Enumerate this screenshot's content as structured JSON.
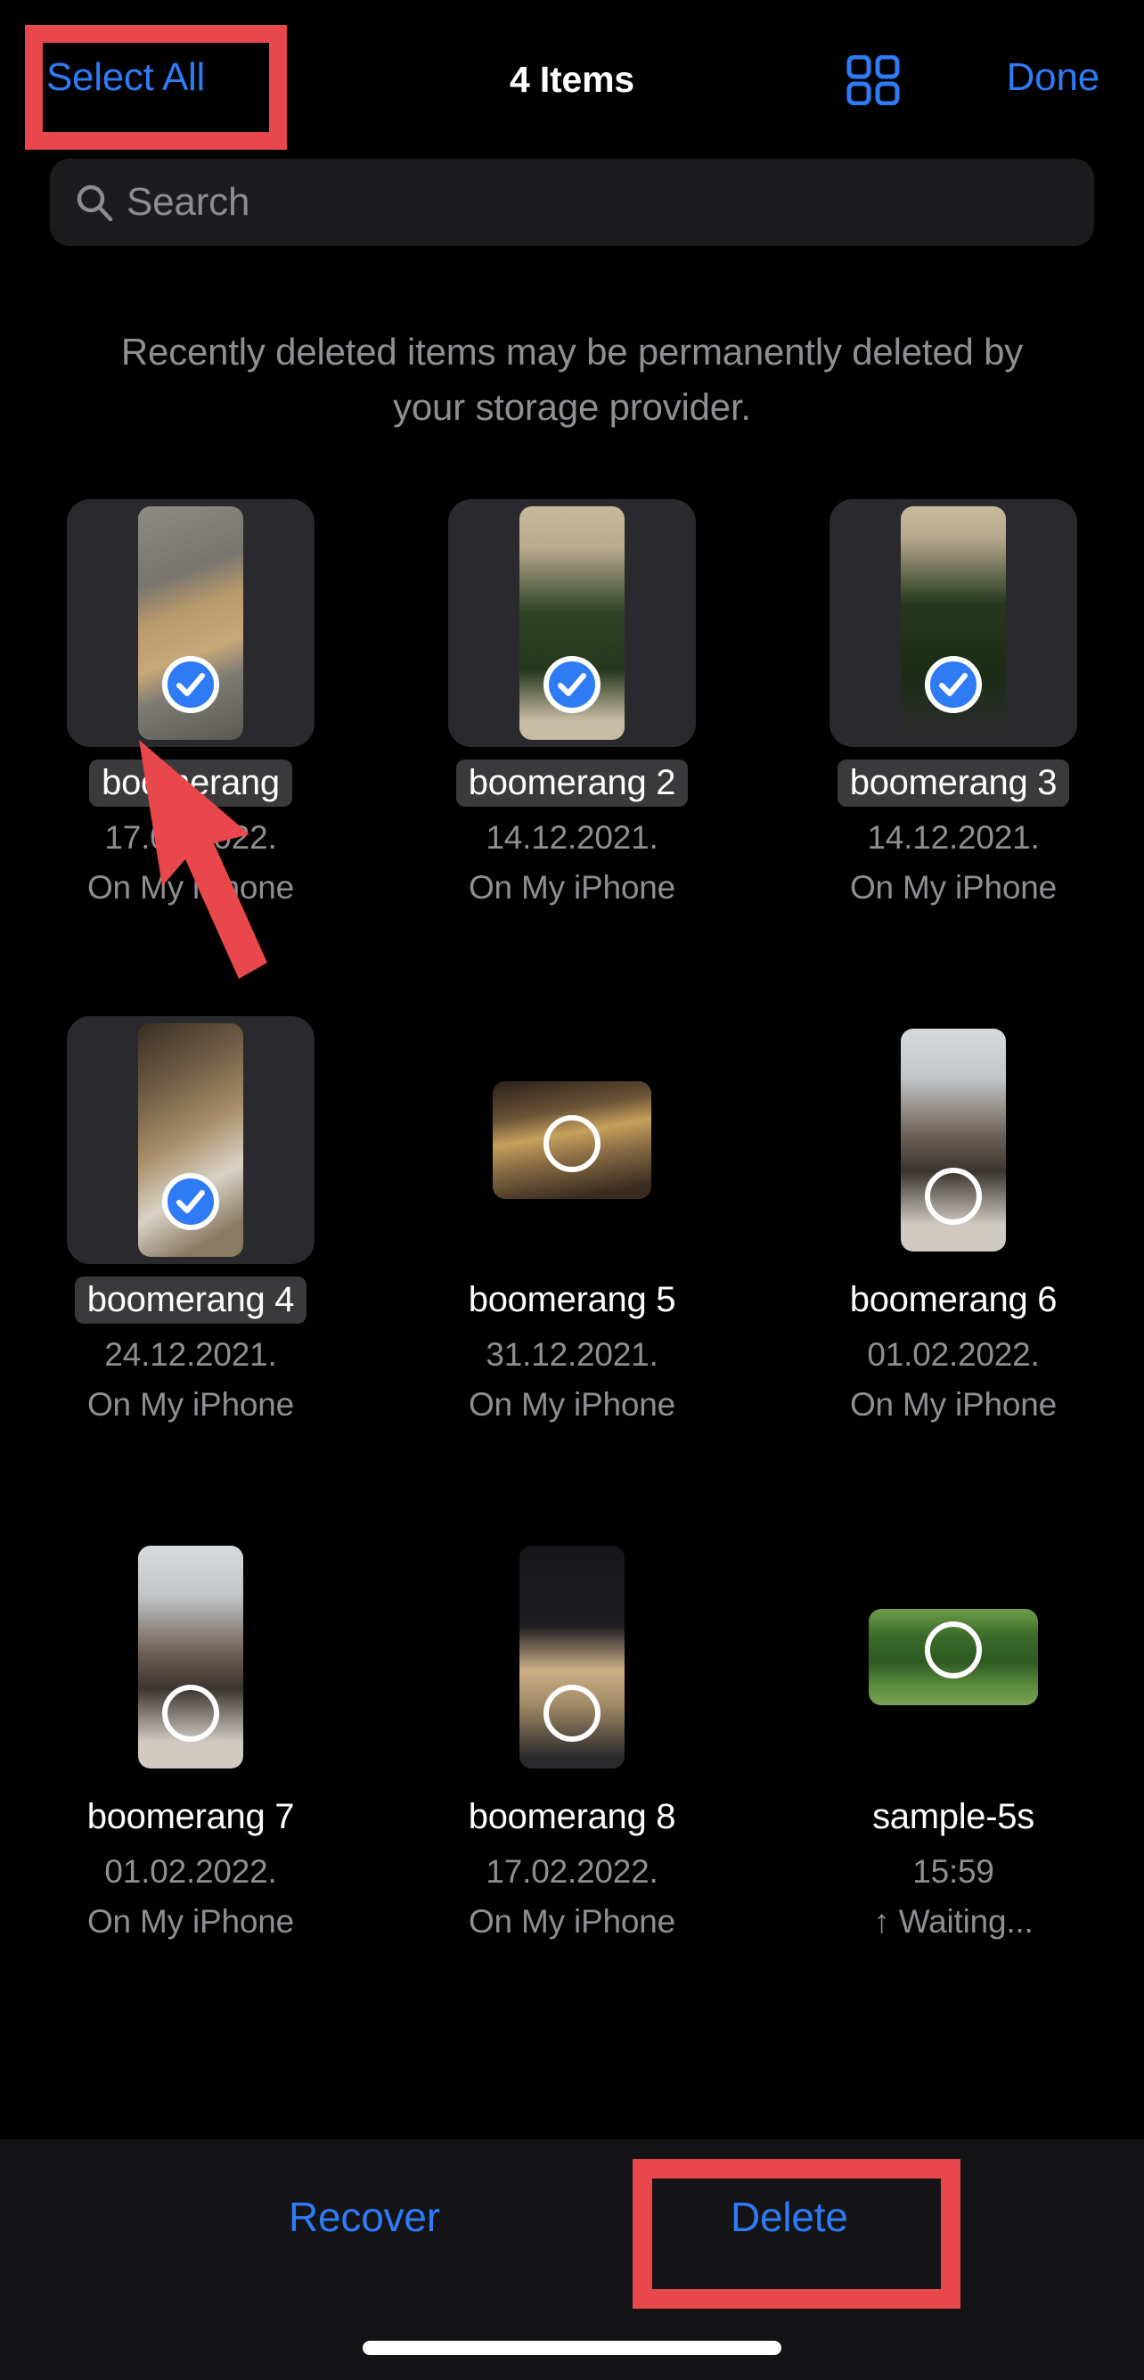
{
  "header": {
    "select_all_label": "Select All",
    "title": "4 Items",
    "grid_icon": "grid-view-icon",
    "done_label": "Done"
  },
  "search": {
    "placeholder": "Search",
    "icon": "search-icon",
    "value": ""
  },
  "notice": "Recently deleted items may be permanently deleted by your storage provider.",
  "items": [
    {
      "name": "boomerang",
      "date": "17.02.2022.",
      "location": "On My iPhone",
      "selected": true,
      "shape": "portrait",
      "art": "box"
    },
    {
      "name": "boomerang 2",
      "date": "14.12.2021.",
      "location": "On My iPhone",
      "selected": true,
      "shape": "portrait",
      "art": "tree1"
    },
    {
      "name": "boomerang 3",
      "date": "14.12.2021.",
      "location": "On My iPhone",
      "selected": true,
      "shape": "portrait",
      "art": "tree2"
    },
    {
      "name": "boomerang 4",
      "date": "24.12.2021.",
      "location": "On My iPhone",
      "selected": true,
      "shape": "portrait",
      "art": "room"
    },
    {
      "name": "boomerang 5",
      "date": "31.12.2021.",
      "location": "On My iPhone",
      "selected": false,
      "shape": "landscape",
      "art": "bar"
    },
    {
      "name": "boomerang 6",
      "date": "01.02.2022.",
      "location": "On My iPhone",
      "selected": false,
      "shape": "portrait-sm",
      "art": "salon"
    },
    {
      "name": "boomerang 7",
      "date": "01.02.2022.",
      "location": "On My iPhone",
      "selected": false,
      "shape": "portrait-sm",
      "art": "salon"
    },
    {
      "name": "boomerang 8",
      "date": "17.02.2022.",
      "location": "On My iPhone",
      "selected": false,
      "shape": "portrait-sm",
      "art": "chair"
    },
    {
      "name": "sample-5s",
      "date": "15:59",
      "location": "↑ Waiting...",
      "selected": false,
      "shape": "landscape-w",
      "art": "park"
    }
  ],
  "toolbar": {
    "recover_label": "Recover",
    "delete_label": "Delete"
  },
  "annotations": {
    "color": "#E8474C",
    "highlight_select_all": "Select All",
    "highlight_delete": "Delete",
    "arrow_points_to": "first item checkmark"
  },
  "colors": {
    "accent_blue": "#2F7BF6",
    "background": "#000000",
    "secondary_text": "#8E8E93",
    "annotation_red": "#E8474C",
    "selection_fill": "#2A2A2E"
  }
}
